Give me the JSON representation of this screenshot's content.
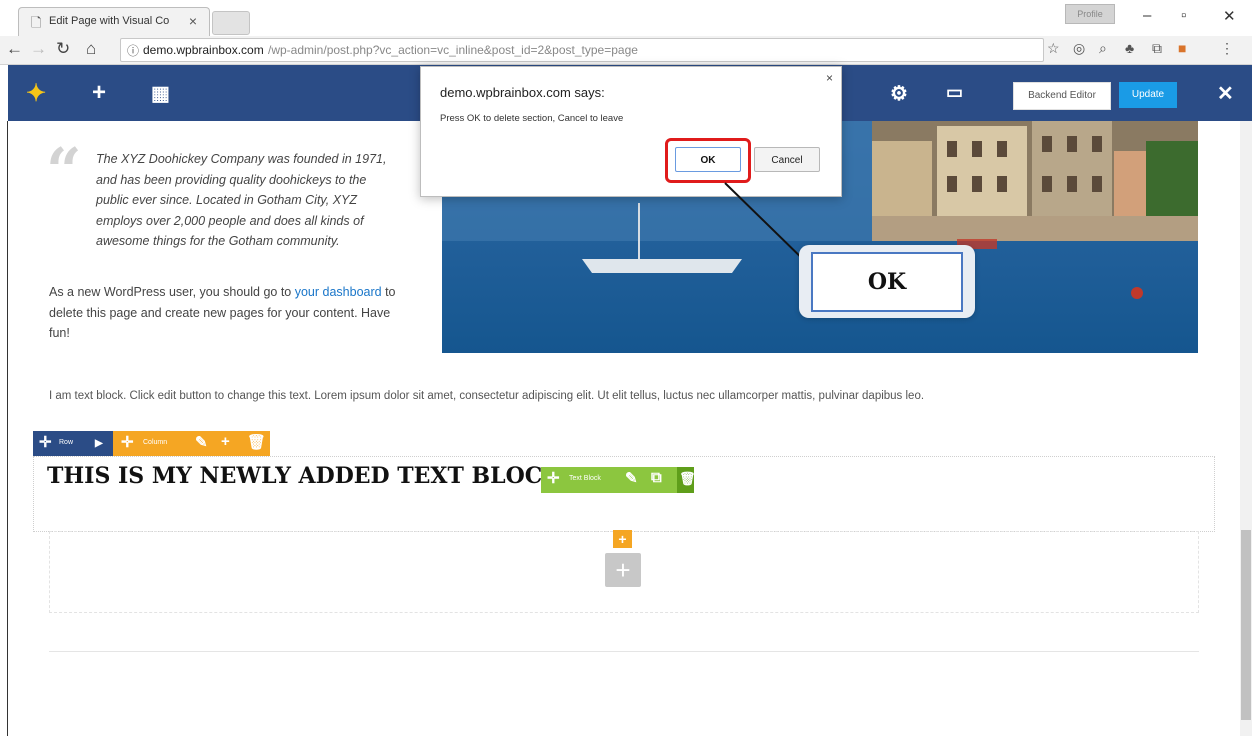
{
  "browser": {
    "tab_title": "Edit Page with Visual Co",
    "tab_close": "×",
    "profile": "Profile",
    "address_domain": "demo.wpbrainbox.com",
    "address_path": "/wp-admin/post.php?vc_action=vc_inline&post_id=2&post_type=page",
    "minimize": "–",
    "maximize": "▫",
    "close": "✕"
  },
  "vc_header": {
    "backend_editor": "Backend Editor",
    "update": "Update",
    "close": "✕"
  },
  "content": {
    "quote": "The XYZ Doohickey Company was founded in 1971, and has been providing quality doohickeys to the public ever since. Located in Gotham City, XYZ employs over 2,000 people and does all kinds of awesome things for the Gotham community.",
    "para_before": "As a new WordPress user, you should go to ",
    "para_link": "your dashboard",
    "para_after": " to delete this page and create new pages for your content. Have fun!",
    "text_block": "I am text block. Click edit button to change this text. Lorem ipsum dolor sit amet, consectetur adipiscing elit. Ut elit tellus, luctus nec ullamcorper mattis, pulvinar dapibus leo.",
    "heading": "THIS IS MY NEWLY ADDED TEXT BLOC"
  },
  "controls": {
    "row_label": "Row",
    "column_label": "Column",
    "text_block_label": "Text Block"
  },
  "dialog": {
    "title": "demo.wpbrainbox.com says:",
    "message": "Press OK to delete section, Cancel to leave",
    "ok": "OK",
    "cancel": "Cancel",
    "close": "×"
  },
  "callout": {
    "label": "OK"
  },
  "colors": {
    "vc_header": "#2b4c86",
    "update_button": "#1a9be6",
    "row_control": "#2b4c86",
    "column_control": "#f5a623",
    "text_block_control": "#8cc63f",
    "highlight": "#e01b1b"
  }
}
